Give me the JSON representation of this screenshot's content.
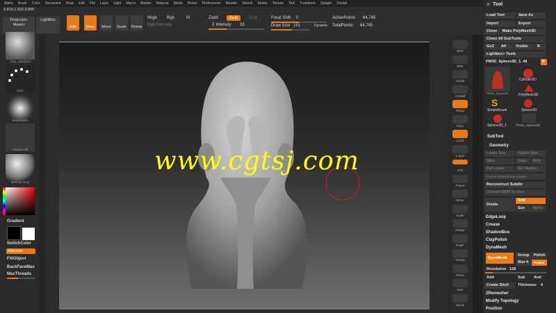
{
  "menu": [
    "Alpha",
    "Brush",
    "Color",
    "Document",
    "Draw",
    "Edit",
    "File",
    "Layer",
    "Light",
    "Macro",
    "Marker",
    "Material",
    "Movie",
    "Picker",
    "Preferences",
    "Render",
    "Stencil",
    "Stroke",
    "Texture",
    "Tool",
    "Transform",
    "Zplugin",
    "Zscript"
  ],
  "coords": "0.819,1.522,0.855",
  "top": {
    "projection_master": "Projection\nMaster",
    "lightbox": "LightBox",
    "edit": "Edit",
    "draw": "Draw",
    "move": "Move",
    "scale": "Scale",
    "rotate": "Rotate",
    "mrgb": "Mrgb",
    "rgb": "Rgb",
    "m": "M",
    "rgb_intensity": "Rgb Intensity",
    "zadd": "Zadd",
    "zsub": "Zsub",
    "zcut": "Zcut",
    "z_intensity_label": "Z Intensity",
    "z_intensity": "33",
    "focal_shift_label": "Focal Shift",
    "focal_shift": "0",
    "draw_size_label": "Draw Size",
    "draw_size": "151",
    "dynamic": "Dynamic",
    "active_points_label": "ActivePoints:",
    "active_points": "64,745",
    "total_points_label": "TotalPoints:",
    "total_points": "64,745"
  },
  "left": {
    "brush_label": "Clay_Standard",
    "stroke_label": "Dots",
    "alpha_label": "BrushAlpha",
    "texture_label": "Texture Off",
    "material_label": "MatCap Gray",
    "gradient": "Gradient",
    "switch_color": "SwitchColor",
    "alternate": "Alternate",
    "fill_object": "FillObject",
    "backface_mask": "BackFaceMas",
    "max_threads": "MaxThreads"
  },
  "right_shelf": [
    "BPR",
    "SPix",
    "Actual",
    "AAHalf",
    "Persp",
    "Floor",
    "Local",
    "L.Sym",
    "XYZ",
    "Frame",
    "Move",
    "Scale",
    "Rotate",
    "PolyF",
    "Transp",
    "Ghost",
    "Solo",
    "Xpose"
  ],
  "tool": {
    "title": "Tool",
    "load_tool": "Load Tool",
    "save_as": "Save As",
    "import": "Import",
    "export": "Export",
    "clone": "Clone",
    "make_polymesh": "Make PolyMesh3D",
    "clone_all": "Clone All SubTools",
    "goz": "GoZ",
    "all": "All",
    "visible": "Visible",
    "r": "R",
    "lightbox_tools": "Lightbox> Tools",
    "current_tool": "PM3D_Sphere3D_1. 49",
    "r2": "R",
    "thumbs": [
      "PM3D_Sphere3D",
      "Cylinder3D",
      "PolyMesh3D",
      "SimpleBrush",
      "Sphere3D",
      "Sphere3D_1",
      "PM3D_Sphere3D"
    ],
    "subtool": "SubTool",
    "geometry": "Geometry",
    "lower_res": "Lower Res",
    "higher_res": "Higher Res",
    "sdiv": "SDiv",
    "cage": "Cage",
    "rstr": "Rstr",
    "del_lower": "Del Lower",
    "del_higher": "Del Higher",
    "freeze": "Freeze SubDivision Levels",
    "reconstruct": "Reconstruct Subdiv",
    "convert_bpr": "Convert BPR To Geo",
    "divide": "Divide",
    "smt": "Smt",
    "suv": "Suv",
    "ruvs": "RUVs",
    "edgeloop": "EdgeLoop",
    "crease": "Crease",
    "shadowbox": "ShadowBox",
    "claypolish": "ClayPolish",
    "dynamesh_section": "DynaMesh",
    "dynamesh": "DynaMesh",
    "group": "Group",
    "polish": "Polish",
    "blur": "Blur",
    "blur_val": "4",
    "project": "Project",
    "resolution_label": "Resolution",
    "resolution": "128",
    "add": "Add",
    "sub": "Sub",
    "and": "And",
    "create_shell": "Create Shell",
    "thickness_label": "Thickness",
    "thickness": "4",
    "zremesher": "ZRemesher",
    "modify_topology": "Modify Topology",
    "position": "Position"
  },
  "watermark": "www.cgtsj.com",
  "colors": {
    "accent": "#e87a1a",
    "panel": "#2b2b2b",
    "button": "#3a3a3a",
    "watermark": "#ffff00"
  }
}
